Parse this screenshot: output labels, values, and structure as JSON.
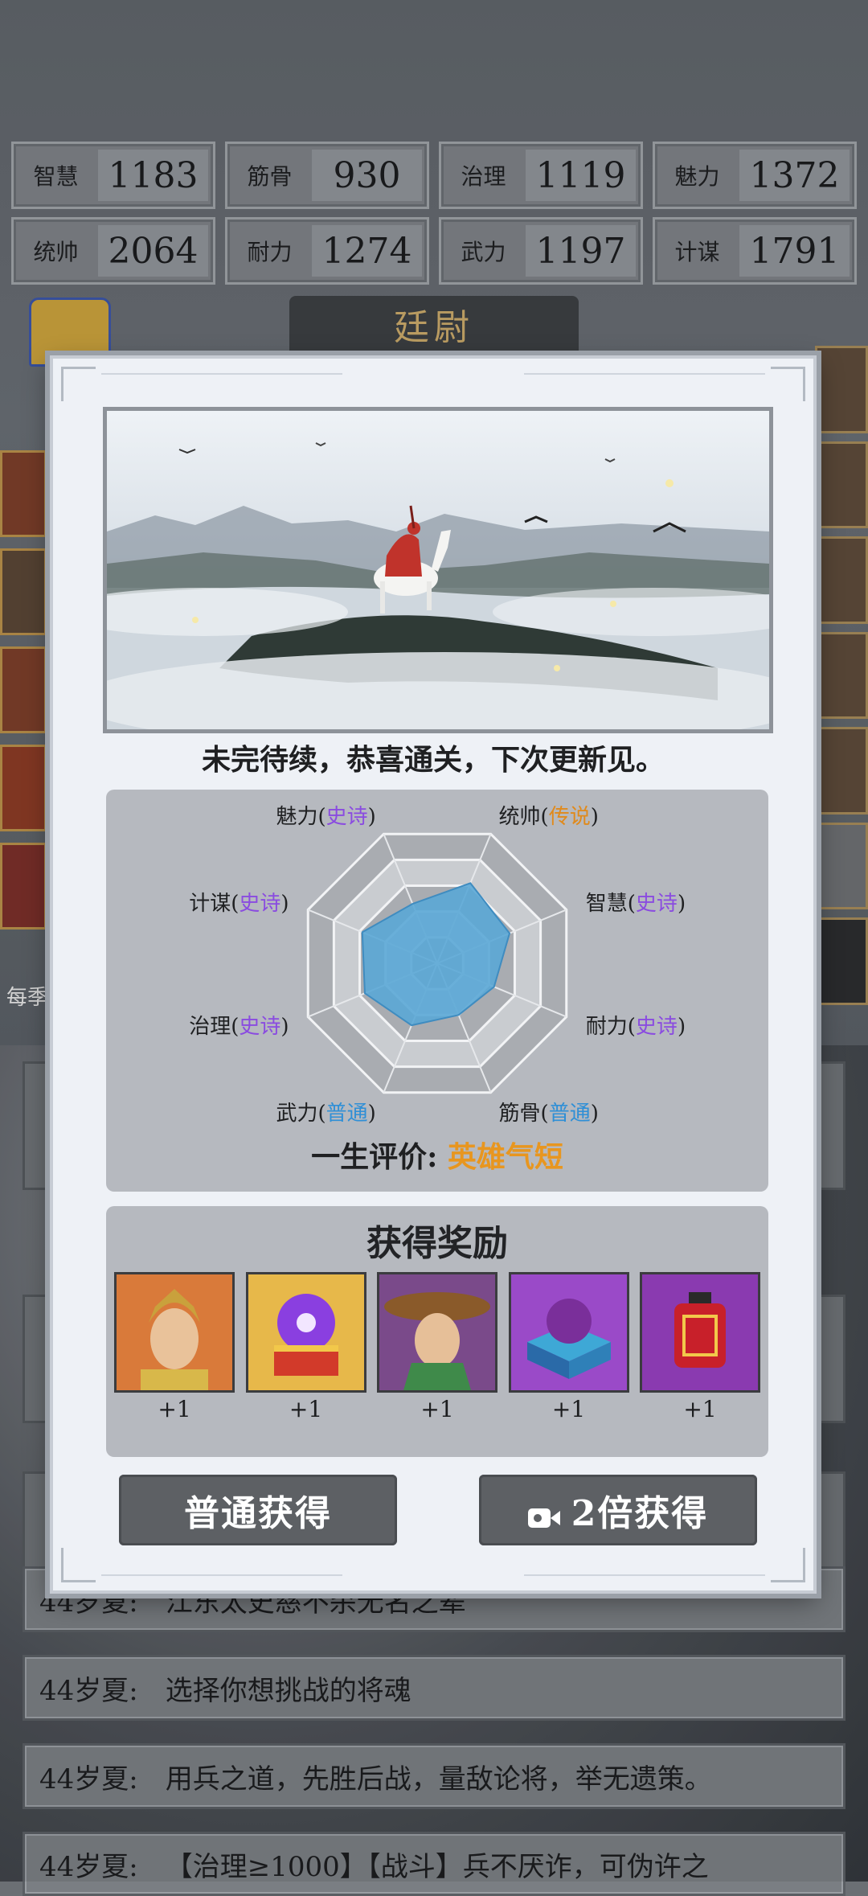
{
  "stats": [
    {
      "label": "智慧",
      "value": "1183"
    },
    {
      "label": "筋骨",
      "value": "930"
    },
    {
      "label": "治理",
      "value": "1119"
    },
    {
      "label": "魅力",
      "value": "1372"
    },
    {
      "label": "统帅",
      "value": "2064"
    },
    {
      "label": "耐力",
      "value": "1274"
    },
    {
      "label": "武力",
      "value": "1197"
    },
    {
      "label": "计谋",
      "value": "1791"
    }
  ],
  "background": {
    "title": "廷尉",
    "season_label": "每季",
    "events": [
      {
        "age": "44岁夏:",
        "text": "江东太史慈不杀无名之辈"
      },
      {
        "age": "44岁夏:",
        "text": "选择你想挑战的将魂"
      },
      {
        "age": "44岁夏:",
        "text": "用兵之道，先胜后战，量敌论将，举无遗策。"
      },
      {
        "age": "44岁夏:",
        "text": "【治理≥1000】【战斗】兵不厌诈，可伪许之"
      }
    ]
  },
  "modal": {
    "caption": "未完待续，恭喜通关，下次更新见。",
    "radar": {
      "attributes": [
        {
          "name": "统帅",
          "grade": "传说",
          "grade_type": "legend",
          "level": 0.62
        },
        {
          "name": "智慧",
          "grade": "史诗",
          "grade_type": "epic",
          "level": 0.56
        },
        {
          "name": "耐力",
          "grade": "史诗",
          "grade_type": "epic",
          "level": 0.44
        },
        {
          "name": "筋骨",
          "grade": "普通",
          "grade_type": "normal",
          "level": 0.4
        },
        {
          "name": "武力",
          "grade": "普通",
          "grade_type": "normal",
          "level": 0.48
        },
        {
          "name": "治理",
          "grade": "史诗",
          "grade_type": "epic",
          "level": 0.56
        },
        {
          "name": "计谋",
          "grade": "史诗",
          "grade_type": "epic",
          "level": 0.58
        },
        {
          "name": "魅力",
          "grade": "史诗",
          "grade_type": "epic",
          "level": 0.46
        }
      ],
      "evaluation_label": "一生评价:",
      "evaluation_value": "英雄气短"
    },
    "rewards": {
      "title": "获得奖励",
      "items": [
        {
          "icon": "general-portrait-icon",
          "count": "+1"
        },
        {
          "icon": "purple-orb-chest-icon",
          "count": "+1"
        },
        {
          "icon": "hat-warrior-portrait-icon",
          "count": "+1"
        },
        {
          "icon": "purple-orb-box-icon",
          "count": "+1"
        },
        {
          "icon": "red-lantern-icon",
          "count": "+1"
        }
      ]
    },
    "buttons": {
      "normal": "普通获得",
      "double": "2倍获得"
    }
  },
  "colors": {
    "epic": "#8a4be0",
    "legend": "#e08a1c",
    "normal": "#2f8fd6",
    "radar_fill": "#5aa7d6",
    "evaluation": "#e8961f"
  }
}
